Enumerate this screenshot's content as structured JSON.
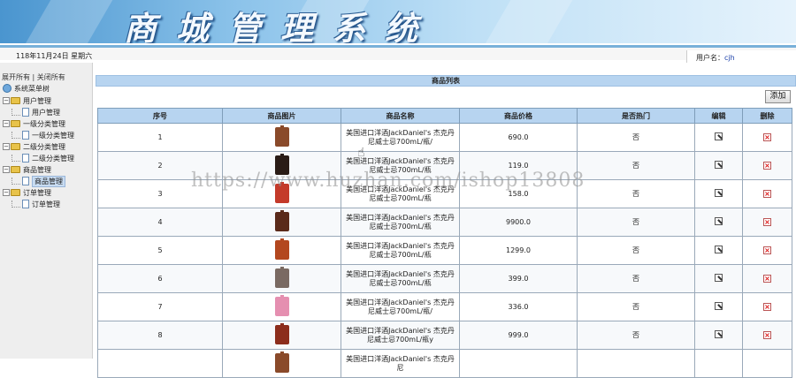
{
  "header": {
    "title": "商城管理系统"
  },
  "infobar": {
    "date": "118年11月24日 星期六",
    "user_label": "用户名：",
    "user_name": "cjh"
  },
  "sidebar": {
    "expand_all": "展开所有",
    "separator": "|",
    "collapse_all": "关闭所有",
    "root": "系统菜单树",
    "groups": [
      {
        "label": "用户管理",
        "child": "用户管理"
      },
      {
        "label": "一级分类管理",
        "child": "一级分类管理"
      },
      {
        "label": "二级分类管理",
        "child": "二级分类管理"
      },
      {
        "label": "商品管理",
        "child": "商品管理"
      },
      {
        "label": "订单管理",
        "child": "订单管理"
      }
    ]
  },
  "main": {
    "caption": "商品列表",
    "add_label": "添加",
    "columns": [
      "序号",
      "商品图片",
      "商品名称",
      "商品价格",
      "是否热门",
      "编辑",
      "删除"
    ],
    "rows": [
      {
        "no": "1",
        "name": "美国进口洋酒JackDaniel's 杰克丹尼威士忌700mL/瓶/",
        "price": "690.0",
        "hot": "否",
        "img": "#8a4a2a"
      },
      {
        "no": "2",
        "name": "美国进口洋酒JackDaniel's 杰克丹尼威士忌700mL/瓶",
        "price": "119.0",
        "hot": "否",
        "img": "#2a1c16"
      },
      {
        "no": "3",
        "name": "美国进口洋酒JackDaniel's 杰克丹尼威士忌700mL/瓶",
        "price": "158.0",
        "hot": "否",
        "img": "#c43a2a"
      },
      {
        "no": "4",
        "name": "美国进口洋酒JackDaniel's 杰克丹尼威士忌700mL/瓶",
        "price": "9900.0",
        "hot": "否",
        "img": "#5a2a1a"
      },
      {
        "no": "5",
        "name": "美国进口洋酒JackDaniel's 杰克丹尼威士忌700mL/瓶",
        "price": "1299.0",
        "hot": "否",
        "img": "#b3471f"
      },
      {
        "no": "6",
        "name": "美国进口洋酒JackDaniel's 杰克丹尼威士忌700mL/瓶",
        "price": "399.0",
        "hot": "否",
        "img": "#7a6a62"
      },
      {
        "no": "7",
        "name": "美国进口洋酒JackDaniel's 杰克丹尼威士忌700mL/瓶/",
        "price": "336.0",
        "hot": "否",
        "img": "#e58fb0"
      },
      {
        "no": "8",
        "name": "美国进口洋酒JackDaniel's 杰克丹尼威士忌700mL/瓶y",
        "price": "999.0",
        "hot": "否",
        "img": "#8c2d1c"
      },
      {
        "no": "",
        "name": "美国进口洋酒JackDaniel's 杰克丹尼",
        "price": "",
        "hot": "",
        "img": "#8a4a2a"
      }
    ]
  },
  "watermark": "https://www.huzhan.com/ishop13808",
  "icons": {
    "edit": "edit-icon",
    "delete": "delete-icon",
    "folder": "folder-icon",
    "page": "page-icon"
  }
}
